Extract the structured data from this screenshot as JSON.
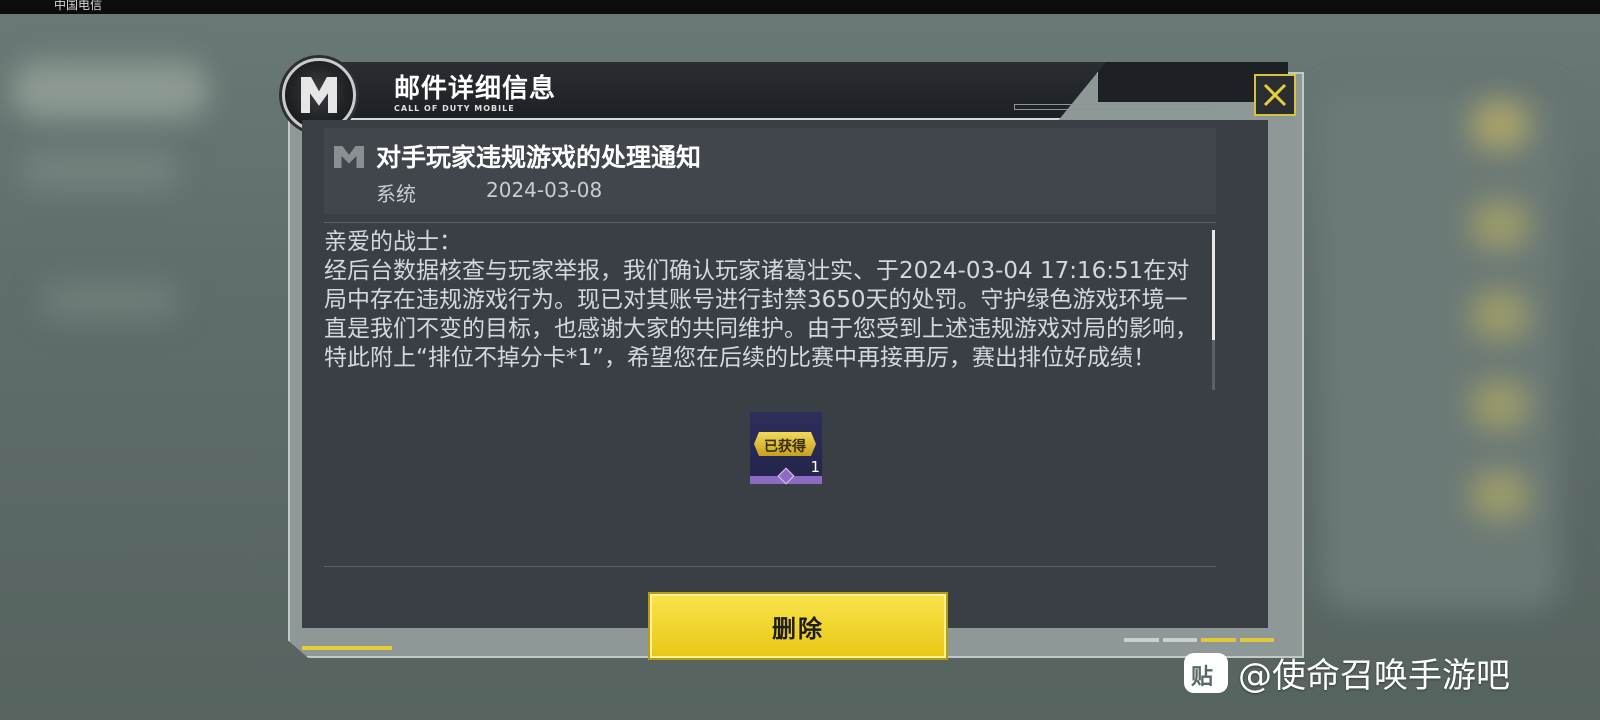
{
  "status_bar": {
    "carrier": "中国电信"
  },
  "modal": {
    "title": "邮件详细信息",
    "subtitle": "CALL OF DUTY MOBILE",
    "close_icon": "close-x-icon"
  },
  "mail": {
    "title": "对手玩家违规游戏的处理通知",
    "sender": "系统",
    "date": "2024-03-08",
    "body": "亲爱的战士：\n经后台数据核查与玩家举报，我们确认玩家诸葛壮实、于2024-03-04 17:16:51在对局中存在违规游戏行为。现已对其账号进行封禁3650天的处罚。守护绿色游戏环境一直是我们不变的目标，也感谢大家的共同维护。由于您受到上述违规游戏对局的影响，特此附上“排位不掉分卡*1”，希望您在后续的比赛中再接再厉，赛出排位好成绩！"
  },
  "reward": {
    "status_label": "已获得",
    "count": "1"
  },
  "actions": {
    "delete_label": "删除"
  },
  "watermark": {
    "logo_char": "贴",
    "text": "@使命召唤手游吧"
  },
  "colors": {
    "accent_yellow": "#f2d62e",
    "panel": "#3a3f46",
    "frame": "#8e9896",
    "reward_purple": "#8e6ac4"
  }
}
